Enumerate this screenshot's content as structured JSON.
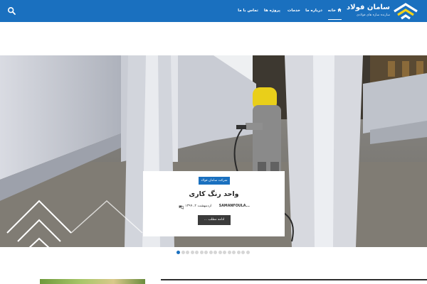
{
  "header": {
    "logo_title": "سامان فولاد",
    "logo_subtitle": "سازنده سازه های فولادی",
    "nav": [
      {
        "label": "خانه",
        "icon": "home-icon",
        "active": true
      },
      {
        "label": "درباره ما",
        "active": false
      },
      {
        "label": "خدمات",
        "active": false
      },
      {
        "label": "پروژه ها",
        "active": false
      },
      {
        "label": "تماس با ما",
        "active": false
      }
    ],
    "search_icon": "search-icon"
  },
  "slider": {
    "badge": "شرکت سامان فولاد",
    "title": "واحد رنگ کاری",
    "author": "SAMANFOULA...",
    "date": "اردیبهشت ۴، ۱۳۹۹",
    "comment_icon": "comments-icon",
    "read_more": "ادامه مطلب ...",
    "dot_count": 16,
    "active_dot": 1
  },
  "colors": {
    "header_bg": "#1a70bf",
    "accent": "#1a70bf",
    "button_bg": "#3b3b3b"
  }
}
